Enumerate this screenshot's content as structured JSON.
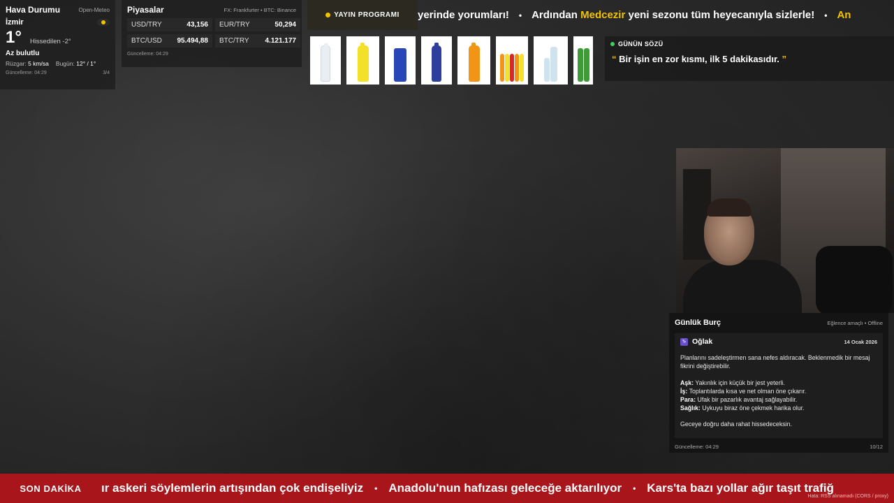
{
  "weather": {
    "title": "Hava Durumu",
    "source": "Open-Meteo",
    "city": "İzmir",
    "temp": "1°",
    "feels": "Hissedilen -2°",
    "condition": "Az bulutlu",
    "wind_label": "Rüzgar:",
    "wind_value": "5 km/sa",
    "today_label": "Bugün:",
    "today_value": "12° / 1°",
    "updated": "Güncelleme: 04:29",
    "page": "3/4"
  },
  "markets": {
    "title": "Piyasalar",
    "source": "FX: Frankfurter • BTC: Binance",
    "items": [
      {
        "symbol": "USD/TRY",
        "value": "43,156"
      },
      {
        "symbol": "EUR/TRY",
        "value": "50,294"
      },
      {
        "symbol": "BTC/USD",
        "value": "95.494,88"
      },
      {
        "symbol": "BTC/TRY",
        "value": "4.121.177"
      }
    ],
    "updated": "Güncelleme: 04:29"
  },
  "program": {
    "label": "YAYIN PROGRAMI",
    "ticker_a": "yerinde yorumları!",
    "ticker_b_pre": "Ardından",
    "ticker_b_hl": "Medcezir",
    "ticker_b_post": "yeni sezonu tüm heyecanıyla sizlerle!",
    "ticker_c": "An",
    "separator": "•"
  },
  "quote": {
    "label": "GÜNÜN SÖZÜ",
    "open_mark": "“",
    "close_mark": "”",
    "text": "Bir işin en zor kısmı, ilk 5 dakikasıdır."
  },
  "horoscope": {
    "title": "Günlük Burç",
    "source": "Eğlence amaçlı • Offline",
    "sign_icon": "♑",
    "sign": "Oğlak",
    "date": "14 Ocak 2026",
    "summary": "Planlarını sadeleştirmen sana nefes aldıracak. Beklenmedik bir mesaj fikrini değiştirebilir.",
    "love_label": "Aşk:",
    "love": "Yakınlık için küçük bir jest yeterli.",
    "work_label": "İş:",
    "work": "Toplantılarda kısa ve net olman öne çıkarır.",
    "money_label": "Para:",
    "money": "Ufak bir pazarlık avantaj sağlayabilir.",
    "health_label": "Sağlık:",
    "health": "Uykuyu biraz öne çekmek harika olur.",
    "closing": "Geceye doğru daha rahat hissedeceksin.",
    "updated": "Güncelleme: 04:29",
    "page": "10/12"
  },
  "breaking": {
    "label": "SON DAKİKA",
    "items": [
      "ır askeri söylemlerin artışından çok endişeliyiz",
      "Anadolu'nun hafızası geleceğe aktarılıyor",
      "Kars'ta bazı yollar ağır taşıt trafiğ"
    ],
    "separator": "•",
    "error": "Hata: RSS alınamadı (CORS / proxy)"
  },
  "colors": {
    "accent": "#f2c300",
    "breaking_bg": "#a8161b",
    "live_dot": "#3fd35b"
  }
}
